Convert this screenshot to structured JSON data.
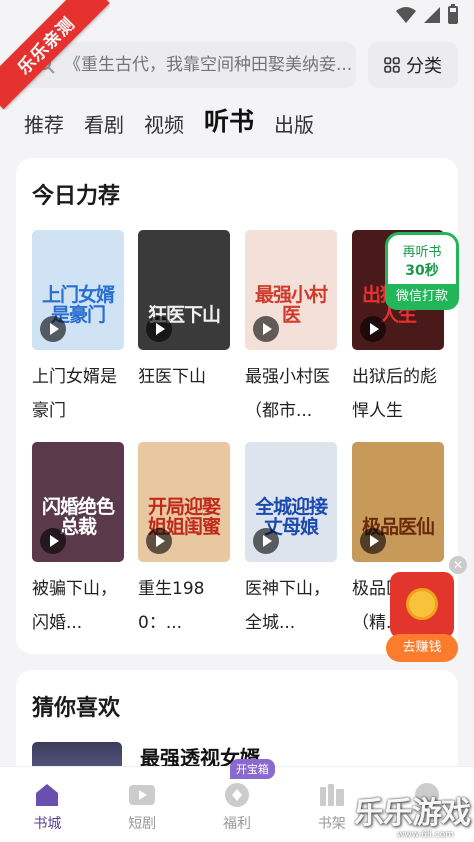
{
  "watermark_corner": "乐乐亲测",
  "search": {
    "placeholder": "《重生古代，我靠空间种田娶美纳妾..."
  },
  "category_button": {
    "label": "分类"
  },
  "top_tabs": [
    {
      "label": "推荐",
      "active": false
    },
    {
      "label": "看剧",
      "active": false
    },
    {
      "label": "视频",
      "active": false
    },
    {
      "label": "听书",
      "active": true
    },
    {
      "label": "出版",
      "active": false
    }
  ],
  "today_section": {
    "title": "今日力荐",
    "books": [
      {
        "title": "上门女婿是豪门",
        "cover_text": "上门女婿是豪门",
        "cover_bg": "#cfe3f5",
        "cover_color": "#2a6fd0"
      },
      {
        "title": "狂医下山",
        "cover_text": "狂医下山",
        "cover_bg": "#3a3a3a",
        "cover_color": "#f0f0f0"
      },
      {
        "title": "最强小村医（都市...",
        "cover_text": "最强小村医",
        "cover_bg": "#f3e0d8",
        "cover_color": "#d03a2a"
      },
      {
        "title": "出狱后的彪悍人生",
        "cover_text": "出狱后的人生",
        "cover_bg": "#4a1a1a",
        "cover_color": "#e83030"
      },
      {
        "title": "被骗下山，闪婚...",
        "cover_text": "闪婚绝色总裁",
        "cover_bg": "#5a3a4a",
        "cover_color": "#ffffff"
      },
      {
        "title": "重生1980：...",
        "cover_text": "开局迎娶姐姐闺蜜",
        "cover_bg": "#e8c8a0",
        "cover_color": "#c02a1a"
      },
      {
        "title": "医神下山，全城...",
        "cover_text": "全城迎接丈母娘",
        "cover_bg": "#dde4ee",
        "cover_color": "#1a4ab0"
      },
      {
        "title": "极品医仙（精...",
        "cover_text": "极品医仙",
        "cover_bg": "#c89a5a",
        "cover_color": "#6a2a0a"
      }
    ]
  },
  "float_ad": {
    "line1": "再听书",
    "line2": "30秒",
    "line3": "微信打款"
  },
  "red_packet": {
    "label": "去赚钱",
    "coin": "币"
  },
  "guess_section": {
    "title": "猜你喜欢",
    "first_book": "最强透视女婿"
  },
  "bottom_nav": [
    {
      "label": "书城",
      "icon": "home-icon",
      "active": true
    },
    {
      "label": "短剧",
      "icon": "play-icon",
      "active": false
    },
    {
      "label": "福利",
      "icon": "gift-icon",
      "active": false,
      "badge": "开宝箱"
    },
    {
      "label": "书架",
      "icon": "bookshelf-icon",
      "active": false
    },
    {
      "label": "",
      "icon": "profile-icon",
      "active": false
    }
  ],
  "watermark": {
    "main": "乐乐游戏",
    "sub": "www.6ll.com"
  }
}
